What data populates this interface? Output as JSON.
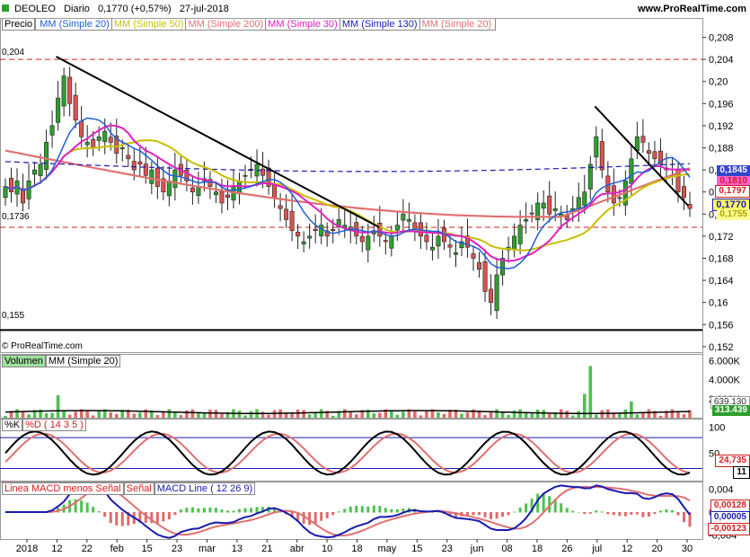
{
  "header": {
    "symbol": "DEOLEO",
    "period": "Diario",
    "price_change": "0,1770 (+0,57%)",
    "date": "27-jul-2018",
    "brand": "www.ProRealTime.com"
  },
  "colors": {
    "up": "#2ca02c",
    "down": "#d9534f",
    "mm20": "#1f5fd6",
    "mm50": "#c8c000",
    "mm200": "#e07070",
    "mm30": "#e020c0",
    "mm130": "#1a1ab0",
    "hline_red": "#d02020"
  },
  "price_panel": {
    "title": "Precio",
    "legend": [
      {
        "label": "MM (Simple 20)",
        "color": "#1f5fd6"
      },
      {
        "label": "MM (Simple 50)",
        "color": "#c8c000"
      },
      {
        "label": "MM (Simple 200)",
        "color": "#e07070"
      },
      {
        "label": "MM (Simple 30)",
        "color": "#e020c0"
      },
      {
        "label": "MM (Simple 130)",
        "color": "#1a1ab0"
      },
      {
        "label": "MM (Simple 20)",
        "color": "#e07070"
      }
    ],
    "level_labels": [
      "0,204",
      "0,1736",
      "0,155"
    ],
    "copyright": "© ProRealTime.com",
    "last_tags": [
      "0,1845",
      "0,1810",
      "0,1797",
      "0,1770",
      "0,1755"
    ]
  },
  "volume_panel": {
    "title": "Volumen",
    "legend": "MM (Simple 20)",
    "ticks": [
      "6.000K",
      "4.000K",
      "2.000K"
    ],
    "last_tags": [
      "639.130",
      "313.439"
    ]
  },
  "stoch_panel": {
    "title1": "%K",
    "title2": "%D ( 14 3 5 )",
    "ticks": [
      "100",
      "50"
    ],
    "last_tags": [
      "24,735",
      "11"
    ]
  },
  "macd_panel": {
    "title1": "Linea MACD menos Señal",
    "title2": "Señal",
    "title3": "MACD Line ( 12 26 9)",
    "ticks": [
      "0,004",
      "0",
      "-0,004"
    ],
    "last_tags": [
      "0,00128",
      "0,00005",
      "-0,00123"
    ]
  },
  "x_axis": {
    "labels": [
      "2018",
      "12",
      "22",
      "feb",
      "15",
      "23",
      "mar",
      "13",
      "21",
      "abr",
      "10",
      "18",
      "may",
      "15",
      "23",
      "jun",
      "08",
      "18",
      "26",
      "jul",
      "12",
      "20",
      "30"
    ]
  },
  "chart_data": {
    "type": "candlestick",
    "title": "DEOLEO Diario",
    "ylim": [
      0.151,
      0.2115
    ],
    "y_ticks": [
      0.152,
      0.156,
      0.16,
      0.164,
      0.168,
      0.172,
      0.176,
      0.18,
      0.184,
      0.188,
      0.192,
      0.196,
      0.2,
      0.204,
      0.208
    ],
    "horizontal_levels": [
      0.204,
      0.1736,
      0.155
    ],
    "trendlines": [
      {
        "from": [
          0.08,
          0.2045
        ],
        "to": [
          0.54,
          0.1736
        ]
      },
      {
        "from": [
          0.847,
          0.1955
        ],
        "to": [
          0.98,
          0.1775
        ]
      }
    ],
    "close_series": [
      0.181,
      0.18,
      0.182,
      0.178,
      0.182,
      0.184,
      0.185,
      0.189,
      0.192,
      0.197,
      0.201,
      0.196,
      0.193,
      0.19,
      0.189,
      0.188,
      0.19,
      0.191,
      0.189,
      0.187,
      0.188,
      0.186,
      0.184,
      0.185,
      0.183,
      0.184,
      0.181,
      0.18,
      0.182,
      0.184,
      0.183,
      0.182,
      0.18,
      0.181,
      0.182,
      0.181,
      0.18,
      0.178,
      0.179,
      0.181,
      0.182,
      0.183,
      0.184,
      0.185,
      0.183,
      0.181,
      0.179,
      0.177,
      0.175,
      0.173,
      0.172,
      0.171,
      0.172,
      0.173,
      0.174,
      0.172,
      0.173,
      0.175,
      0.174,
      0.173,
      0.172,
      0.171,
      0.172,
      0.173,
      0.172,
      0.171,
      0.172,
      0.174,
      0.176,
      0.175,
      0.173,
      0.172,
      0.171,
      0.17,
      0.172,
      0.171,
      0.17,
      0.169,
      0.171,
      0.17,
      0.168,
      0.166,
      0.162,
      0.16,
      0.165,
      0.168,
      0.17,
      0.172,
      0.174,
      0.175,
      0.176,
      0.178,
      0.178,
      0.176,
      0.177,
      0.176,
      0.175,
      0.177,
      0.179,
      0.18,
      0.185,
      0.19,
      0.184,
      0.18,
      0.178,
      0.179,
      0.182,
      0.186,
      0.19,
      0.189,
      0.187,
      0.186,
      0.185,
      0.184,
      0.183,
      0.18,
      0.179,
      0.177
    ],
    "volume_last": 313439,
    "stoch_last": {
      "K": 11,
      "D": 24.735
    },
    "macd_last": {
      "histogram": -0.00123,
      "signal": 0.00128,
      "macd": 5e-05
    }
  }
}
